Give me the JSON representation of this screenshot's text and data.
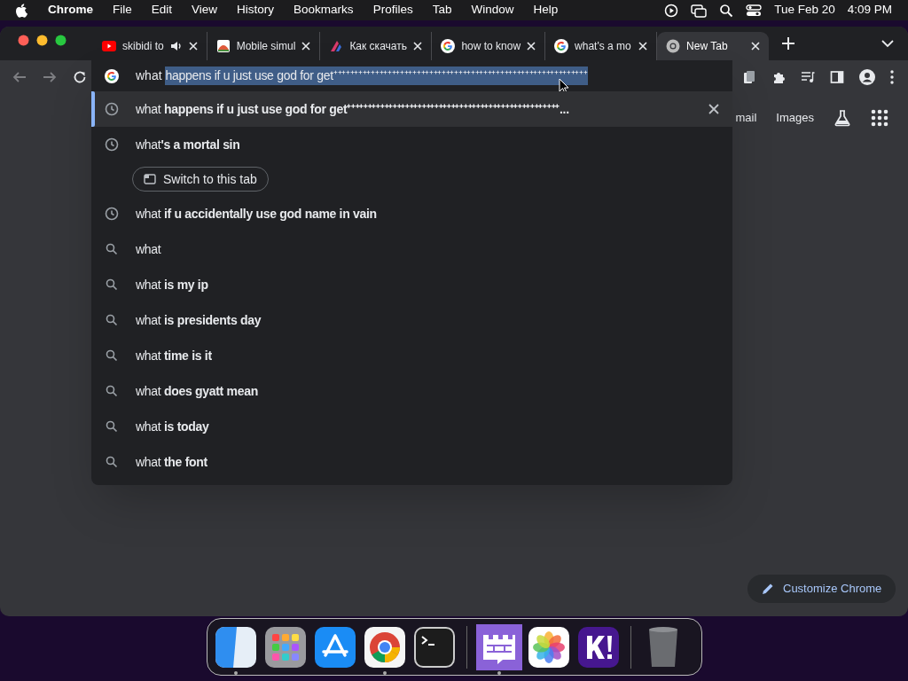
{
  "menu_bar": {
    "app": "Chrome",
    "menus": [
      "File",
      "Edit",
      "View",
      "History",
      "Bookmarks",
      "Profiles",
      "Tab",
      "Window",
      "Help"
    ],
    "date": "Tue Feb 20",
    "time": "4:09 PM"
  },
  "tabs": [
    {
      "title": "skibidi to",
      "kind": "youtube",
      "audio": true,
      "selected": false
    },
    {
      "title": "Mobile simul",
      "kind": "photo",
      "audio": false,
      "selected": false
    },
    {
      "title": "Как скачать",
      "kind": "arrow",
      "audio": false,
      "selected": false
    },
    {
      "title": "how to know",
      "kind": "google",
      "audio": false,
      "selected": false
    },
    {
      "title": "what's a mo",
      "kind": "google",
      "audio": false,
      "selected": false
    },
    {
      "title": "New Tab",
      "kind": "chrome",
      "audio": false,
      "selected": true
    }
  ],
  "omnibox": {
    "typed": "what",
    "selected_completion": "happens if u just use god for get⁺⁺⁺⁺⁺⁺⁺⁺⁺⁺⁺⁺⁺⁺⁺⁺⁺⁺⁺⁺⁺⁺⁺⁺⁺⁺⁺⁺⁺⁺⁺⁺⁺⁺⁺⁺⁺⁺⁺⁺⁺⁺⁺⁺⁺⁺⁺⁺⁺⁺⁺⁺⁺⁺⁺⁺⁺⁺⁺⁺⁺"
  },
  "suggestions": [
    {
      "kind": "history",
      "text": "what **happens if u just use god for get⁺⁺⁺⁺⁺⁺⁺⁺⁺⁺⁺⁺⁺⁺⁺⁺⁺⁺⁺⁺⁺⁺⁺⁺⁺⁺⁺⁺⁺⁺⁺⁺⁺⁺⁺⁺⁺⁺⁺⁺⁺⁺⁺⁺⁺⁺⁺⁺⁺⁺⁺...**",
      "selected": true
    },
    {
      "kind": "history",
      "text": "what**'s a mortal sin**",
      "selected": false,
      "action": "Switch to this tab"
    },
    {
      "kind": "history",
      "text": "what **if u accidentally use god name in vain**",
      "selected": false
    },
    {
      "kind": "search",
      "text": "what",
      "selected": false
    },
    {
      "kind": "search",
      "text": "what **is my ip**",
      "selected": false
    },
    {
      "kind": "search",
      "text": "what **is presidents day**",
      "selected": false
    },
    {
      "kind": "search",
      "text": "what **time is it**",
      "selected": false
    },
    {
      "kind": "search",
      "text": "what **does gyatt mean**",
      "selected": false
    },
    {
      "kind": "search",
      "text": "what **is today**",
      "selected": false
    },
    {
      "kind": "search",
      "text": "what **the font**",
      "selected": false
    }
  ],
  "header_links": [
    "mail",
    "Images"
  ],
  "customize_button": "Customize Chrome",
  "dock": [
    {
      "kind": "finder",
      "running": true
    },
    {
      "kind": "launchpad",
      "running": false
    },
    {
      "kind": "appstore",
      "running": false
    },
    {
      "kind": "chrome",
      "running": true
    },
    {
      "kind": "terminal",
      "running": false
    },
    {
      "kind": "castle",
      "running": true
    },
    {
      "kind": "photos",
      "running": false
    },
    {
      "kind": "kahoot",
      "running": false
    },
    {
      "kind": "trash",
      "running": false
    }
  ]
}
